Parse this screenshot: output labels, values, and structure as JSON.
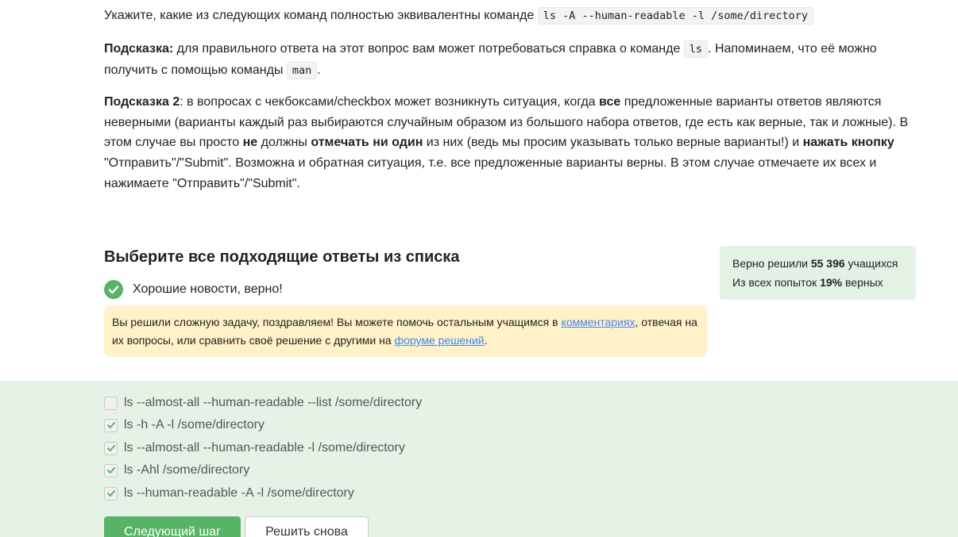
{
  "question": {
    "text": "Укажите, какие из следующих команд полностью эквивалентны команде",
    "command": "ls -A --human-readable -l /some/directory"
  },
  "hint1": {
    "label": "Подсказка:",
    "text_a": " для правильного ответа на этот вопрос вам может потребоваться справка о команде ",
    "code_ls": "ls",
    "text_b": ". Напоминаем, что её можно получить с помощью команды ",
    "code_man": "man",
    "text_c": "."
  },
  "hint2": {
    "label": "Подсказка 2",
    "t1": ": в вопросах с чекбоксами/checkbox может возникнуть ситуация, когда ",
    "b1": "все",
    "t2": " предложенные варианты ответов являются неверными (варианты каждый раз выбираются случайным образом из большого набора ответов, где есть как верные, так и ложные). В этом случае вы просто ",
    "b2": "не",
    "t3": " должны ",
    "b3": "отмечать ни один",
    "t4": " из них (ведь мы просим указывать только верные варианты!) и ",
    "b4": "нажать кнопку",
    "t5": " \"Отправить\"/\"Submit\". Возможна и обратная ситуация, т.е. все предложенные варианты верны. В этом случае отмечаете их всех и нажимаете \"Отправить\"/\"Submit\"."
  },
  "section_title": "Выберите все подходящие ответы из списка",
  "status_text": "Хорошие новости, верно!",
  "notice": {
    "t1": "Вы решили сложную задачу, поздравляем! Вы можете помочь остальным учащимся в ",
    "link1": "комментариях",
    "t2": ", отвечая на их вопросы, или сравнить своё решение с другими на ",
    "link2": "форуме решений",
    "t3": "."
  },
  "stats": {
    "line1_pre": "Верно решили ",
    "solved_count": "55 396",
    "line1_post": " учащихся",
    "line2_pre": "Из всех попыток ",
    "percent": "19%",
    "line2_post": " верных"
  },
  "options": [
    {
      "label": "ls --almost-all --human-readable --list /some/directory",
      "checked": false
    },
    {
      "label": "ls -h -A -l /some/directory",
      "checked": true
    },
    {
      "label": "ls --almost-all --human-readable -l /some/directory",
      "checked": true
    },
    {
      "label": "ls -Ahl /some/directory",
      "checked": true
    },
    {
      "label": "ls --human-readable -A  -l /some/directory",
      "checked": true
    }
  ],
  "buttons": {
    "next": "Следующий шаг",
    "retry": "Решить снова"
  },
  "colors": {
    "success": "#58b465",
    "answers_bg": "#e6f2e6",
    "notice_bg": "#fff1c8",
    "link": "#4485ed"
  }
}
